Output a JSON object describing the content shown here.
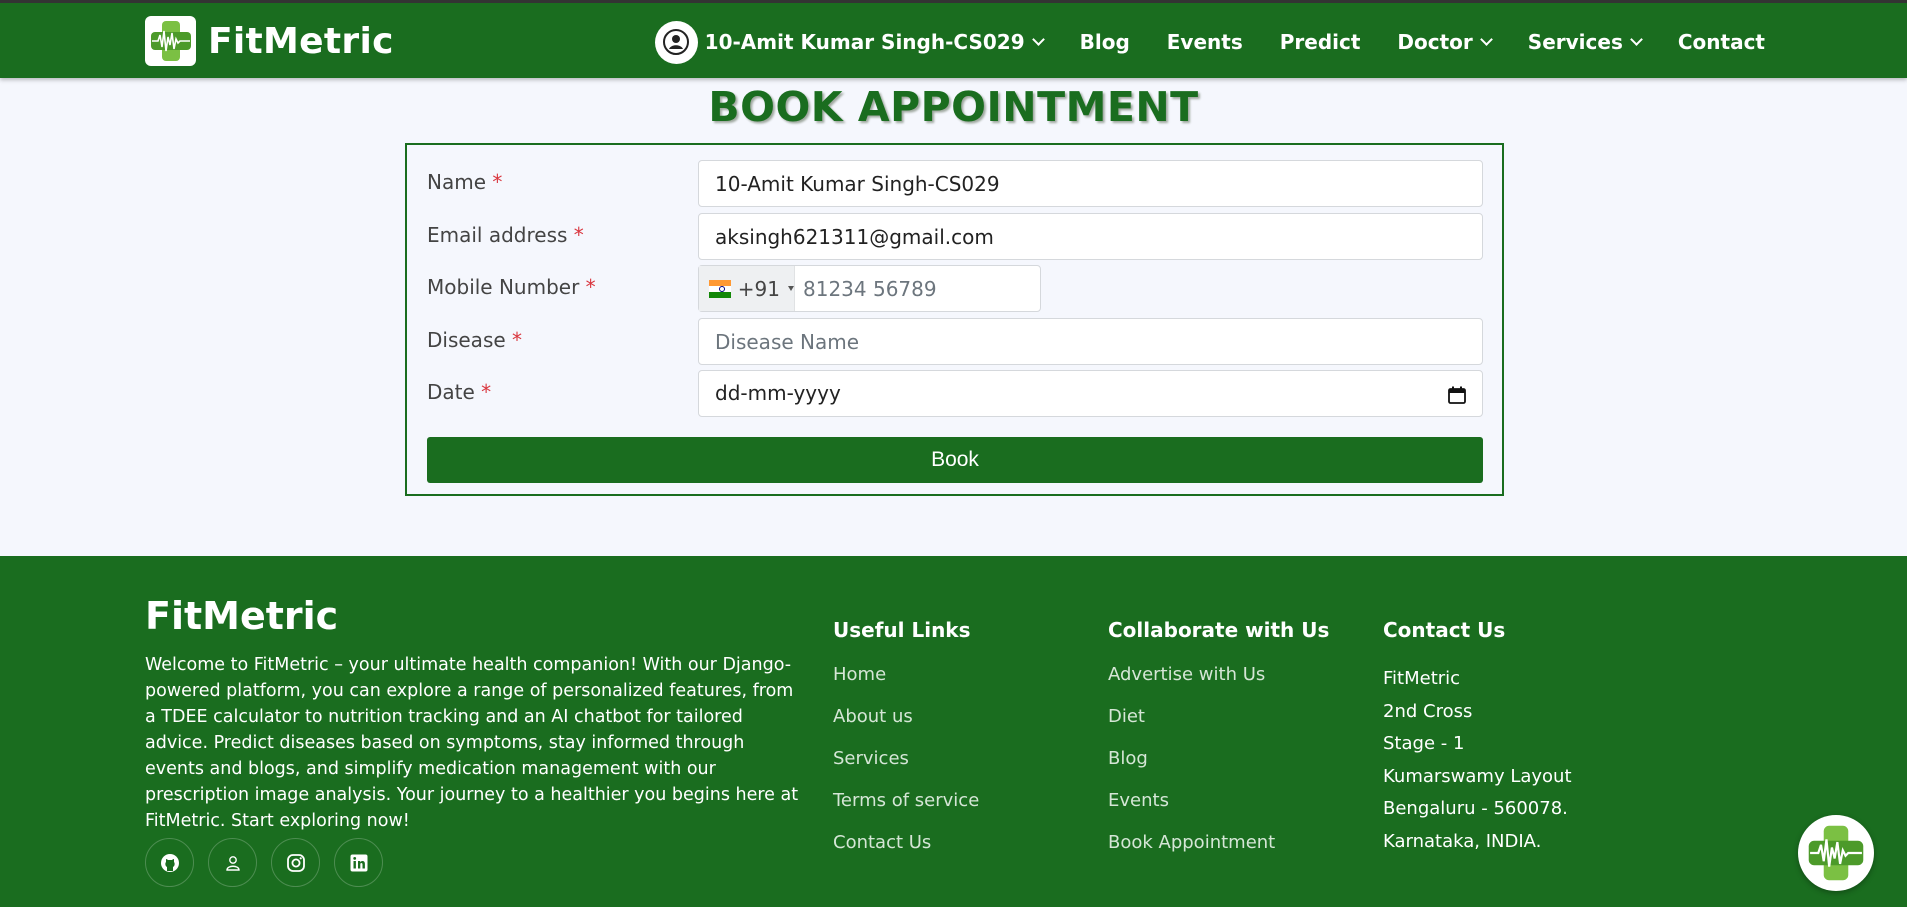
{
  "colors": {
    "primary": "#1a6d1f",
    "required": "#d9363e",
    "background": "#f5f7fd"
  },
  "header": {
    "brand": "FitMetric",
    "user": "10-Amit Kumar Singh-CS029",
    "nav": [
      "Blog",
      "Events",
      "Predict",
      "Doctor",
      "Services",
      "Contact"
    ]
  },
  "form": {
    "title": "BOOK APPOINTMENT",
    "name_label": "Name",
    "name_value": "10-Amit Kumar Singh-CS029",
    "email_label": "Email address",
    "email_value": "aksingh621311@gmail.com",
    "mobile_label": "Mobile Number",
    "country_code": "+91",
    "mobile_placeholder": "81234 56789",
    "disease_label": "Disease",
    "disease_placeholder": "Disease Name",
    "date_label": "Date",
    "date_placeholder": "dd-mm-yyyy",
    "required_mark": "*",
    "submit": "Book"
  },
  "footer": {
    "brand": "FitMetric",
    "about": "Welcome to FitMetric – your ultimate health companion! With our Django-powered platform, you can explore a range of personalized features, from a TDEE calculator to nutrition tracking and an AI chatbot for tailored advice. Predict diseases based on symptoms, stay informed through events and blogs, and simplify medication management with our prescription image analysis. Your journey to a healthier you begins here at FitMetric. Start exploring now!",
    "useful_links_title": "Useful Links",
    "useful_links": [
      "Home",
      "About us",
      "Services",
      "Terms of service",
      "Contact Us"
    ],
    "collab_title": "Collaborate with Us",
    "collab_links": [
      "Advertise with Us",
      "Diet",
      "Blog",
      "Events",
      "Book Appointment"
    ],
    "contact_title": "Contact Us",
    "contact_lines": [
      "FitMetric",
      "2nd Cross",
      "Stage - 1",
      "Kumarswamy Layout",
      "Bengaluru - 560078.",
      "Karnataka, INDIA."
    ],
    "social_icons": [
      "github-icon",
      "user-icon",
      "instagram-icon",
      "linkedin-icon"
    ]
  }
}
